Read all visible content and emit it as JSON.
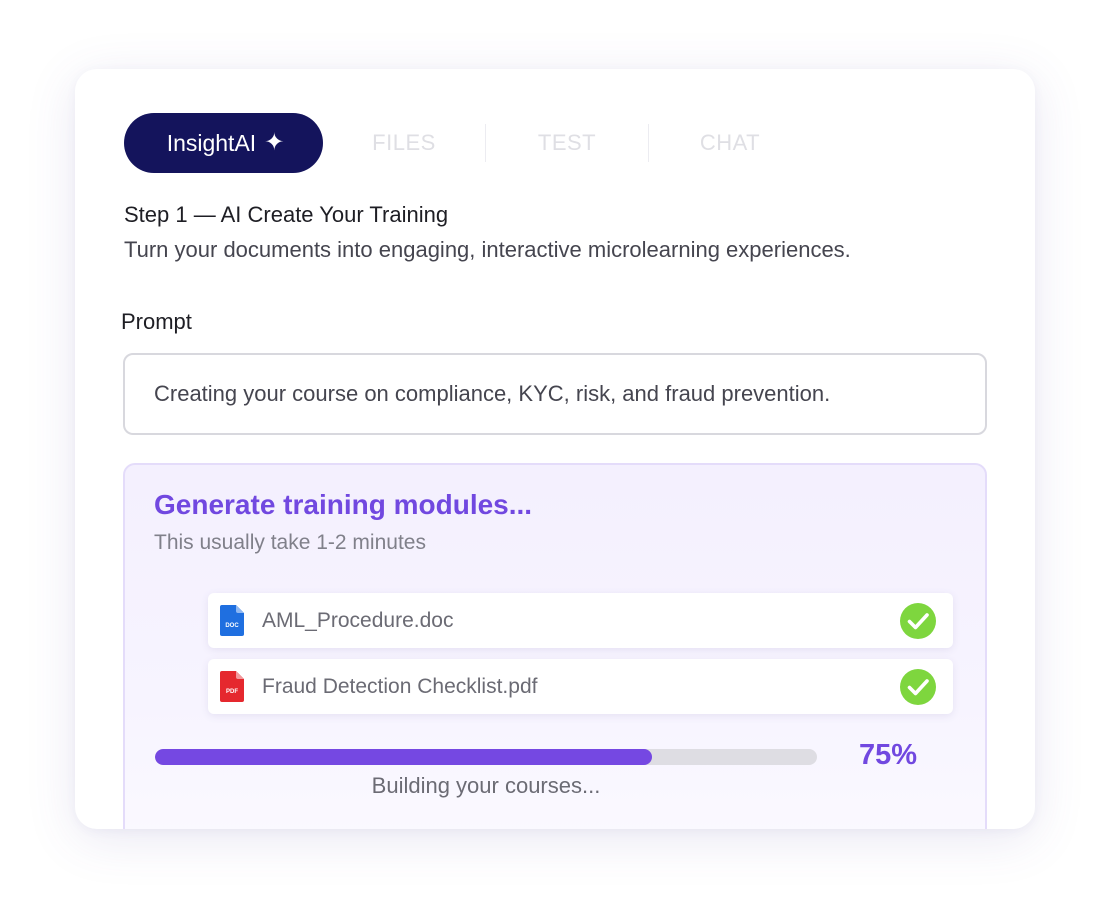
{
  "tabs": {
    "brand": {
      "label": "InsightAI",
      "icon": "sparkle-icon"
    },
    "items": [
      {
        "label": "FILES"
      },
      {
        "label": "TEST"
      },
      {
        "label": "CHAT"
      }
    ]
  },
  "step": {
    "title": "Step 1 — AI Create Your Training",
    "description": "Turn your documents into engaging, interactive microlearning experiences."
  },
  "prompt": {
    "label": "Prompt",
    "value": "Creating your course on compliance, KYC, risk, and fraud prevention."
  },
  "generation": {
    "title": "Generate training modules...",
    "subtitle": "This usually take 1-2 minutes",
    "files": [
      {
        "name": "AML_Procedure.doc",
        "type_badge": "DOC",
        "icon": "doc-file-icon",
        "status": "complete",
        "status_icon": "check-circle-icon"
      },
      {
        "name": "Fraud Detection Checklist.pdf",
        "type_badge": "PDF",
        "icon": "pdf-file-icon",
        "status": "complete",
        "status_icon": "check-circle-icon"
      }
    ],
    "progress": {
      "percent_value": 75,
      "percent_label": "75%",
      "status": "Building your courses..."
    }
  },
  "colors": {
    "brand_navy": "#14145c",
    "accent_purple": "#7148e0",
    "success_green": "#7ed63e",
    "doc_blue": "#1f6fe0",
    "pdf_red": "#e5282e"
  }
}
